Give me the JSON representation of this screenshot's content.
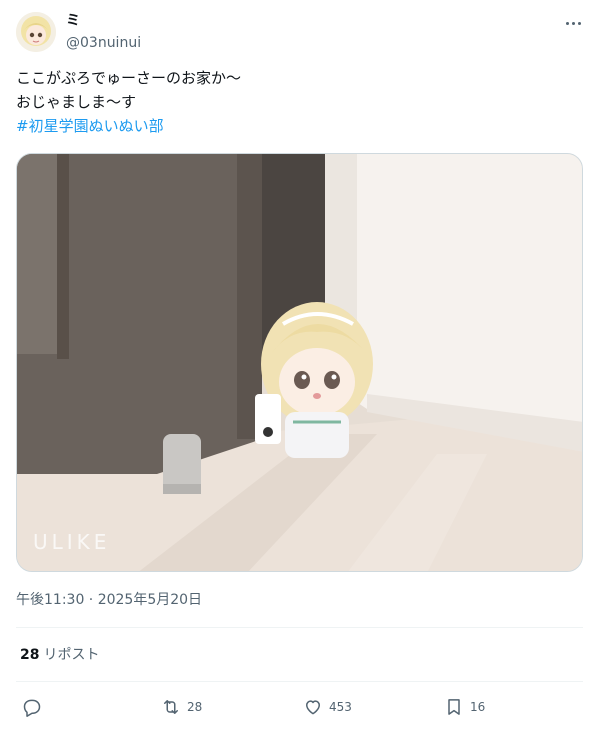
{
  "author": {
    "display_name": "ミ",
    "handle": "@03nuinui",
    "avatar_icon": "avatar-icon"
  },
  "tweet": {
    "text_lines": [
      "ここがぷろでゅーさーのお家か〜",
      "おじゃましま〜す"
    ],
    "hashtag": "#初星学園ぬいぬい部",
    "media_watermark": "ULIKE",
    "timestamp": "午後11:30 · 2025年5月20日"
  },
  "stats": {
    "reposts_count": "28",
    "reposts_label": "リポスト"
  },
  "actions": {
    "reply_count": "",
    "retweet_count": "28",
    "like_count": "453",
    "bookmark_count": "16"
  },
  "colors": {
    "accent": "#1d9bf0",
    "secondary_text": "#536471",
    "primary_text": "#0f1419",
    "divider": "#eff3f4"
  }
}
